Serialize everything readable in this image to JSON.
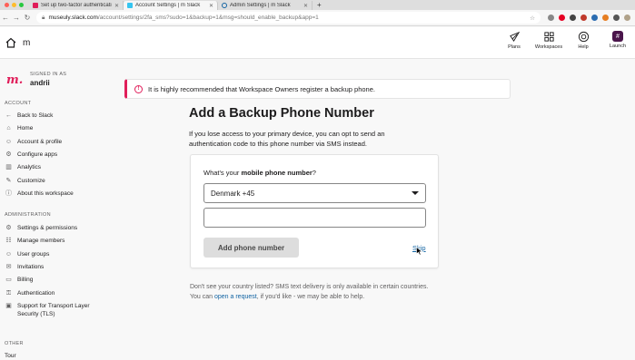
{
  "browser": {
    "tabs": [
      {
        "title": "Set up two-factor authenticati",
        "active": false
      },
      {
        "title": "Account Settings | m Slack",
        "active": true
      },
      {
        "title": "Admin Settings | m Slack",
        "active": false
      }
    ],
    "new_tab": "+",
    "url_host": "museuly.slack.com",
    "url_path": "/account/settings/2fa_sms?sudo=1&backup=1&msg=should_enable_backup&app=1"
  },
  "header": {
    "workspace_letter": "m",
    "nav": [
      {
        "label": "Plans",
        "icon": "rocket-icon"
      },
      {
        "label": "Workspaces",
        "icon": "grid-icon"
      },
      {
        "label": "Help",
        "icon": "lifebuoy-icon"
      },
      {
        "label": "Launch",
        "icon": "slack-launch-icon"
      }
    ]
  },
  "sidebar": {
    "brand": "m.",
    "signed_in_as": "SIGNED IN AS",
    "username": "andrii",
    "account_heading": "ACCOUNT",
    "account_items": [
      {
        "label": "Back to Slack",
        "icon": "arrow-left-icon"
      },
      {
        "label": "Home",
        "icon": "home-icon"
      },
      {
        "label": "Account & profile",
        "icon": "person-icon"
      },
      {
        "label": "Configure apps",
        "icon": "apps-icon"
      },
      {
        "label": "Analytics",
        "icon": "chart-icon"
      },
      {
        "label": "Customize",
        "icon": "brush-icon"
      },
      {
        "label": "About this workspace",
        "icon": "info-icon"
      }
    ],
    "admin_heading": "ADMINISTRATION",
    "admin_items": [
      {
        "label": "Settings & permissions",
        "icon": "gear-icon"
      },
      {
        "label": "Manage members",
        "icon": "people-icon"
      },
      {
        "label": "User groups",
        "icon": "group-icon"
      },
      {
        "label": "Invitations",
        "icon": "envelope-icon"
      },
      {
        "label": "Billing",
        "icon": "card-icon"
      },
      {
        "label": "Authentication",
        "icon": "key-icon"
      },
      {
        "label": "Support for Transport Layer Security (TLS)",
        "icon": "lock-icon"
      }
    ],
    "other_heading": "OTHER",
    "other_items": [
      {
        "label": "Tour"
      }
    ]
  },
  "alert": {
    "text": "It is highly recommended that Workspace Owners register a backup phone."
  },
  "main": {
    "title": "Add a Backup Phone Number",
    "description": "If you lose access to your primary device, you can opt to send an authentication code to this phone number via SMS instead.",
    "question_prefix": "What's your ",
    "question_bold": "mobile phone number",
    "question_suffix": "?",
    "country_selected": "Denmark +45",
    "phone_value": "",
    "add_button": "Add phone number",
    "skip_link": "Skip",
    "footer_line1": "Don't see your country listed? SMS text delivery is only available in certain countries.",
    "footer_prefix": "You can ",
    "footer_link": "open a request",
    "footer_suffix": ", if you'd like - we may be able to help."
  },
  "colors": {
    "accent": "#e01e5a",
    "link": "#1264a3",
    "launch": "#4a154b"
  }
}
